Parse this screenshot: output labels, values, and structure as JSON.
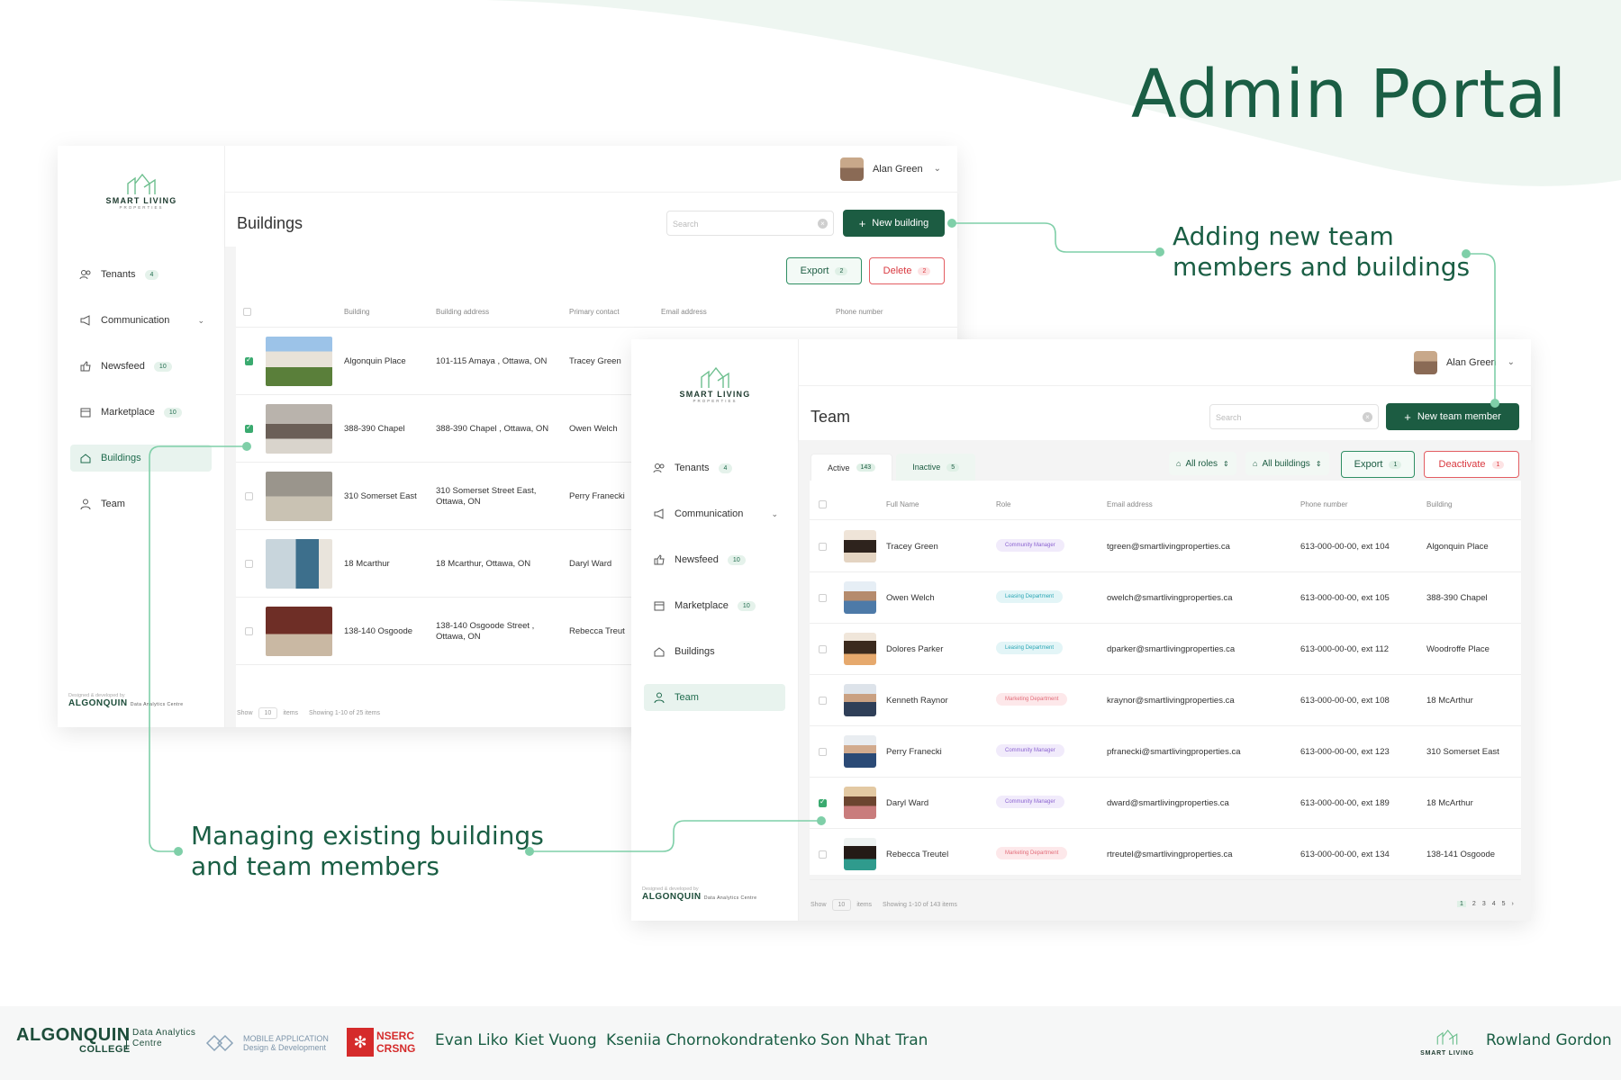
{
  "hero": {
    "title": "Admin Portal"
  },
  "callouts": {
    "adding": [
      "Adding new team",
      "members and buildings"
    ],
    "managing": [
      "Managing existing buildings",
      "and team members"
    ]
  },
  "brand": {
    "name": "SMART LIVING",
    "tagline": "PROPERTIES"
  },
  "user": {
    "name": "Alan Green"
  },
  "credit": {
    "text": "Designed & developed by",
    "college": "ALGONQUIN",
    "college_sub": "COLLEGE",
    "centre": "Data Analytics Centre"
  },
  "nav": [
    {
      "label": "Tenants",
      "icon": "users-icon",
      "badge": "4"
    },
    {
      "label": "Communication",
      "icon": "megaphone-icon",
      "chevron": "⌄"
    },
    {
      "label": "Newsfeed",
      "icon": "thumbs-up-icon",
      "badge": "10"
    },
    {
      "label": "Marketplace",
      "icon": "calendar-icon",
      "badge": "10"
    },
    {
      "label": "Buildings",
      "icon": "home-icon"
    },
    {
      "label": "Team",
      "icon": "person-icon"
    }
  ],
  "buildings_panel": {
    "title": "Buildings",
    "search_placeholder": "Search",
    "new_button": "New building",
    "export_label": "Export",
    "export_count": "2",
    "delete_label": "Delete",
    "delete_count": "2",
    "columns": [
      "Building",
      "Building address",
      "Primary contact",
      "Email address",
      "Phone number"
    ],
    "rows": [
      {
        "building": "Algonquin Place",
        "address": [
          "101-115 Amaya , Ottawa, ON"
        ],
        "contact": "Tracey Green",
        "checked": true
      },
      {
        "building": "388-390 Chapel",
        "address": [
          "388-390 Chapel , Ottawa, ON"
        ],
        "contact": "Owen Welch",
        "checked": true
      },
      {
        "building": "310 Somerset East",
        "address": [
          "310 Somerset Street East,",
          "Ottawa, ON"
        ],
        "contact": "Perry Franecki",
        "checked": false
      },
      {
        "building": "18 Mcarthur",
        "address": [
          "18 Mcarthur, Ottawa, ON"
        ],
        "contact": "Daryl Ward",
        "checked": false
      },
      {
        "building": "138-140 Osgoode",
        "address": [
          "138-140 Osgoode Street ,",
          "Ottawa, ON"
        ],
        "contact": "Rebecca Treut",
        "checked": false
      }
    ],
    "footer": {
      "show": "Show",
      "per_page": "10",
      "items": "items",
      "showing": "Showing 1-10 of 25 items"
    }
  },
  "team_panel": {
    "title": "Team",
    "search_placeholder": "Search",
    "new_button": "New team member",
    "tabs": [
      {
        "label": "Active",
        "count": "143"
      },
      {
        "label": "Inactive",
        "count": "5"
      }
    ],
    "filter_roles": "All roles",
    "filter_buildings": "All buildings",
    "export_label": "Export",
    "export_count": "1",
    "deactivate_label": "Deactivate",
    "deactivate_count": "1",
    "columns": [
      "Full Name",
      "Role",
      "Email address",
      "Phone number",
      "Building"
    ],
    "rows": [
      {
        "name": "Tracey Green",
        "role": "Community Manager",
        "role_type": "cm",
        "email": "tgreen@smartlivingproperties.ca",
        "phone": "613-000-00-00, ext 104",
        "building": "Algonquin Place",
        "checked": false
      },
      {
        "name": "Owen Welch",
        "role": "Leasing Department",
        "role_type": "ld",
        "email": "owelch@smartlivingproperties.ca",
        "phone": "613-000-00-00, ext 105",
        "building": "388-390 Chapel",
        "checked": false
      },
      {
        "name": "Dolores Parker",
        "role": "Leasing Department",
        "role_type": "ld",
        "email": "dparker@smartlivingproperties.ca",
        "phone": "613-000-00-00, ext 112",
        "building": "Woodroffe Place",
        "checked": false
      },
      {
        "name": "Kenneth Raynor",
        "role": "Marketing Department",
        "role_type": "md",
        "email": "kraynor@smartlivingproperties.ca",
        "phone": "613-000-00-00, ext 108",
        "building": "18 McArthur",
        "checked": false
      },
      {
        "name": "Perry Franecki",
        "role": "Community Manager",
        "role_type": "cm",
        "email": "pfranecki@smartlivingproperties.ca",
        "phone": "613-000-00-00, ext 123",
        "building": "310 Somerset East",
        "checked": false
      },
      {
        "name": "Daryl Ward",
        "role": "Community Manager",
        "role_type": "cm",
        "email": "dward@smartlivingproperties.ca",
        "phone": "613-000-00-00, ext 189",
        "building": "18 McArthur",
        "checked": true
      },
      {
        "name": "Rebecca Treutel",
        "role": "Marketing Department",
        "role_type": "md",
        "email": "rtreutel@smartlivingproperties.ca",
        "phone": "613-000-00-00, ext 134",
        "building": "138-141 Osgoode",
        "checked": false
      }
    ],
    "footer": {
      "show": "Show",
      "per_page": "10",
      "items": "items",
      "showing": "Showing 1-10 of 143 items"
    },
    "pages": [
      "1",
      "2",
      "3",
      "4",
      "5",
      "›"
    ]
  },
  "bottom": {
    "college": "ALGONQUIN",
    "college_sub": "COLLEGE",
    "centre": "Data Analytics Centre",
    "mobile_app": [
      "MOBILE APPLICATION",
      "Design & Development"
    ],
    "nserc": [
      "NSERC",
      "CRSNG"
    ],
    "people": [
      "Evan Liko",
      "Kiet Vuong",
      "Kseniia Chornokondratenko",
      "Son Nhat Tran"
    ],
    "brand": "SMART LIVING",
    "right_person": "Rowland Gordon"
  },
  "colors": {
    "brand_green": "#1c5c42",
    "accent_mint": "#7fcfa8",
    "danger": "#d9383f",
    "wave": "#eef6f1"
  }
}
